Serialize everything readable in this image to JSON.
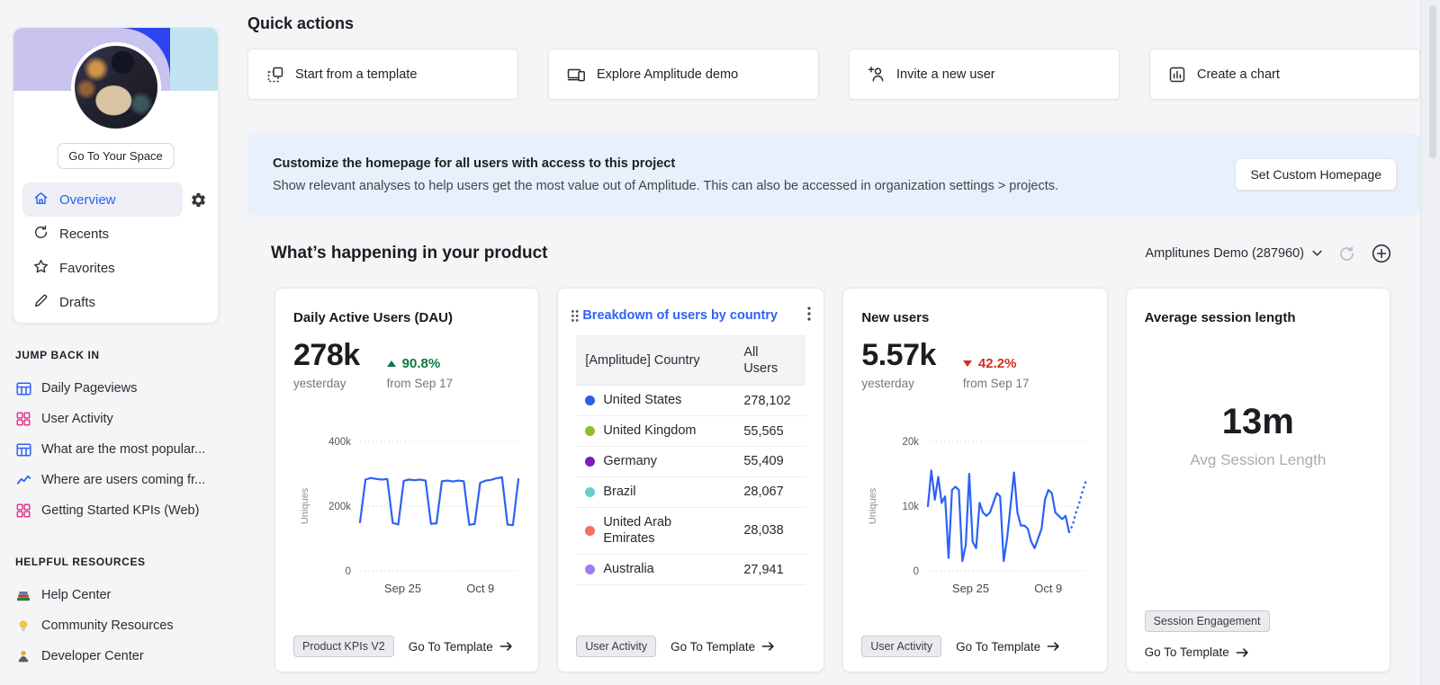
{
  "sidebar": {
    "go_to_space_label": "Go To Your Space",
    "nav": [
      {
        "label": "Overview",
        "active": true
      },
      {
        "label": "Recents",
        "active": false
      },
      {
        "label": "Favorites",
        "active": false
      },
      {
        "label": "Drafts",
        "active": false
      }
    ],
    "jump_back_in_title": "JUMP BACK IN",
    "jump_back_in": [
      {
        "label": "Daily Pageviews",
        "icon": "table-icon"
      },
      {
        "label": "User Activity",
        "icon": "dashboard-icon"
      },
      {
        "label": "What are the most popular...",
        "icon": "table-icon"
      },
      {
        "label": "Where are users coming fr...",
        "icon": "line-chart-icon"
      },
      {
        "label": "Getting Started KPIs (Web)",
        "icon": "dashboard-icon"
      }
    ],
    "helpful_resources_title": "HELPFUL RESOURCES",
    "helpful_resources": [
      {
        "label": "Help Center",
        "icon": "books-icon"
      },
      {
        "label": "Community Resources",
        "icon": "lightbulb-icon"
      },
      {
        "label": "Developer Center",
        "icon": "developer-icon"
      }
    ]
  },
  "quick_actions": {
    "title": "Quick actions",
    "buttons": [
      {
        "label": "Start from a template",
        "icon": "template-icon"
      },
      {
        "label": "Explore Amplitude demo",
        "icon": "devices-icon"
      },
      {
        "label": "Invite a new user",
        "icon": "add-user-icon"
      },
      {
        "label": "Create a chart",
        "icon": "bar-chart-icon"
      }
    ]
  },
  "banner": {
    "title": "Customize the homepage for all users with access to this project",
    "subtitle": "Show relevant analyses to help users get the most value out of Amplitude. This can also be accessed in organization settings > projects.",
    "button_label": "Set Custom Homepage"
  },
  "section": {
    "title": "What’s happening in your product",
    "project_selector": "Amplitunes Demo (287960)"
  },
  "cards": {
    "dau": {
      "title": "Daily Active Users (DAU)",
      "value": "278k",
      "period": "yesterday",
      "delta": "90.8%",
      "delta_direction": "up",
      "delta_note": "from Sep 17",
      "badge": "Product KPIs V2",
      "link": "Go To Template"
    },
    "country": {
      "badge": "User Activity",
      "link": "Go To Template"
    },
    "new_users": {
      "title": "New users",
      "value": "5.57k",
      "period": "yesterday",
      "delta": "42.2%",
      "delta_direction": "down",
      "delta_note": "from Sep 17",
      "badge": "User Activity",
      "link": "Go To Template"
    },
    "session": {
      "title": "Average session length",
      "value": "13m",
      "label": "Avg Session Length",
      "badge": "Session Engagement",
      "link": "Go To Template"
    }
  },
  "colors": {
    "accent_blue": "#2c62f5",
    "positive_green": "#0b7a43",
    "negative_red": "#d92c20",
    "notice_bg": "#e7f0fb"
  },
  "chart_data": [
    {
      "type": "line",
      "title": "Daily Active Users (DAU)",
      "ylabel": "Uniques",
      "ylim": [
        0,
        400000
      ],
      "ytick_labels": [
        "0",
        "200k",
        "400k"
      ],
      "xtick_labels": [
        "Sep 25",
        "Oct 9"
      ],
      "xtick_pos": [
        0.27,
        0.76
      ],
      "line_color": "#2c62f5",
      "grid": true,
      "values_k": [
        150,
        282,
        287,
        284,
        282,
        284,
        148,
        143,
        278,
        282,
        280,
        282,
        279,
        145,
        147,
        277,
        279,
        276,
        279,
        277,
        142,
        145,
        272,
        279,
        281,
        286,
        289,
        143,
        141,
        283
      ]
    },
    {
      "type": "table",
      "title": "Breakdown of users by country",
      "columns": [
        "[Amplitude] Country",
        "All Users"
      ],
      "rows": [
        {
          "country": "United States",
          "value": "278,102",
          "color": "#2d5fe8"
        },
        {
          "country": "United Kingdom",
          "value": "55,565",
          "color": "#8ebe2a"
        },
        {
          "country": "Germany",
          "value": "55,409",
          "color": "#7d1bbd"
        },
        {
          "country": "Brazil",
          "value": "28,067",
          "color": "#63d0cd"
        },
        {
          "country": "United Arab Emirates",
          "value": "28,038",
          "color": "#f4705f"
        },
        {
          "country": "Australia",
          "value": "27,941",
          "color": "#9d7cf4"
        }
      ]
    },
    {
      "type": "line",
      "title": "New users",
      "ylabel": "Uniques",
      "ylim": [
        0,
        20000
      ],
      "ytick_labels": [
        "0",
        "10k",
        "20k"
      ],
      "xtick_labels": [
        "Sep 25",
        "Oct 9"
      ],
      "xtick_pos": [
        0.27,
        0.76
      ],
      "line_color": "#2c62f5",
      "grid": true,
      "values_k": [
        10,
        15.5,
        11,
        14.5,
        10.5,
        11.5,
        2,
        12.5,
        13,
        12.5,
        1.5,
        4,
        15,
        4.5,
        3.5,
        10.5,
        9,
        8.5,
        9,
        10.5,
        12,
        11.5,
        1.5,
        5,
        10,
        15.2,
        9,
        7,
        7,
        6.5,
        4.5,
        3.5,
        5,
        6.5,
        11,
        12.5,
        12,
        9,
        8.5,
        8,
        8.5,
        6
      ],
      "dotted_tail_k": [
        7,
        9,
        10.5,
        12.5,
        14
      ]
    }
  ]
}
